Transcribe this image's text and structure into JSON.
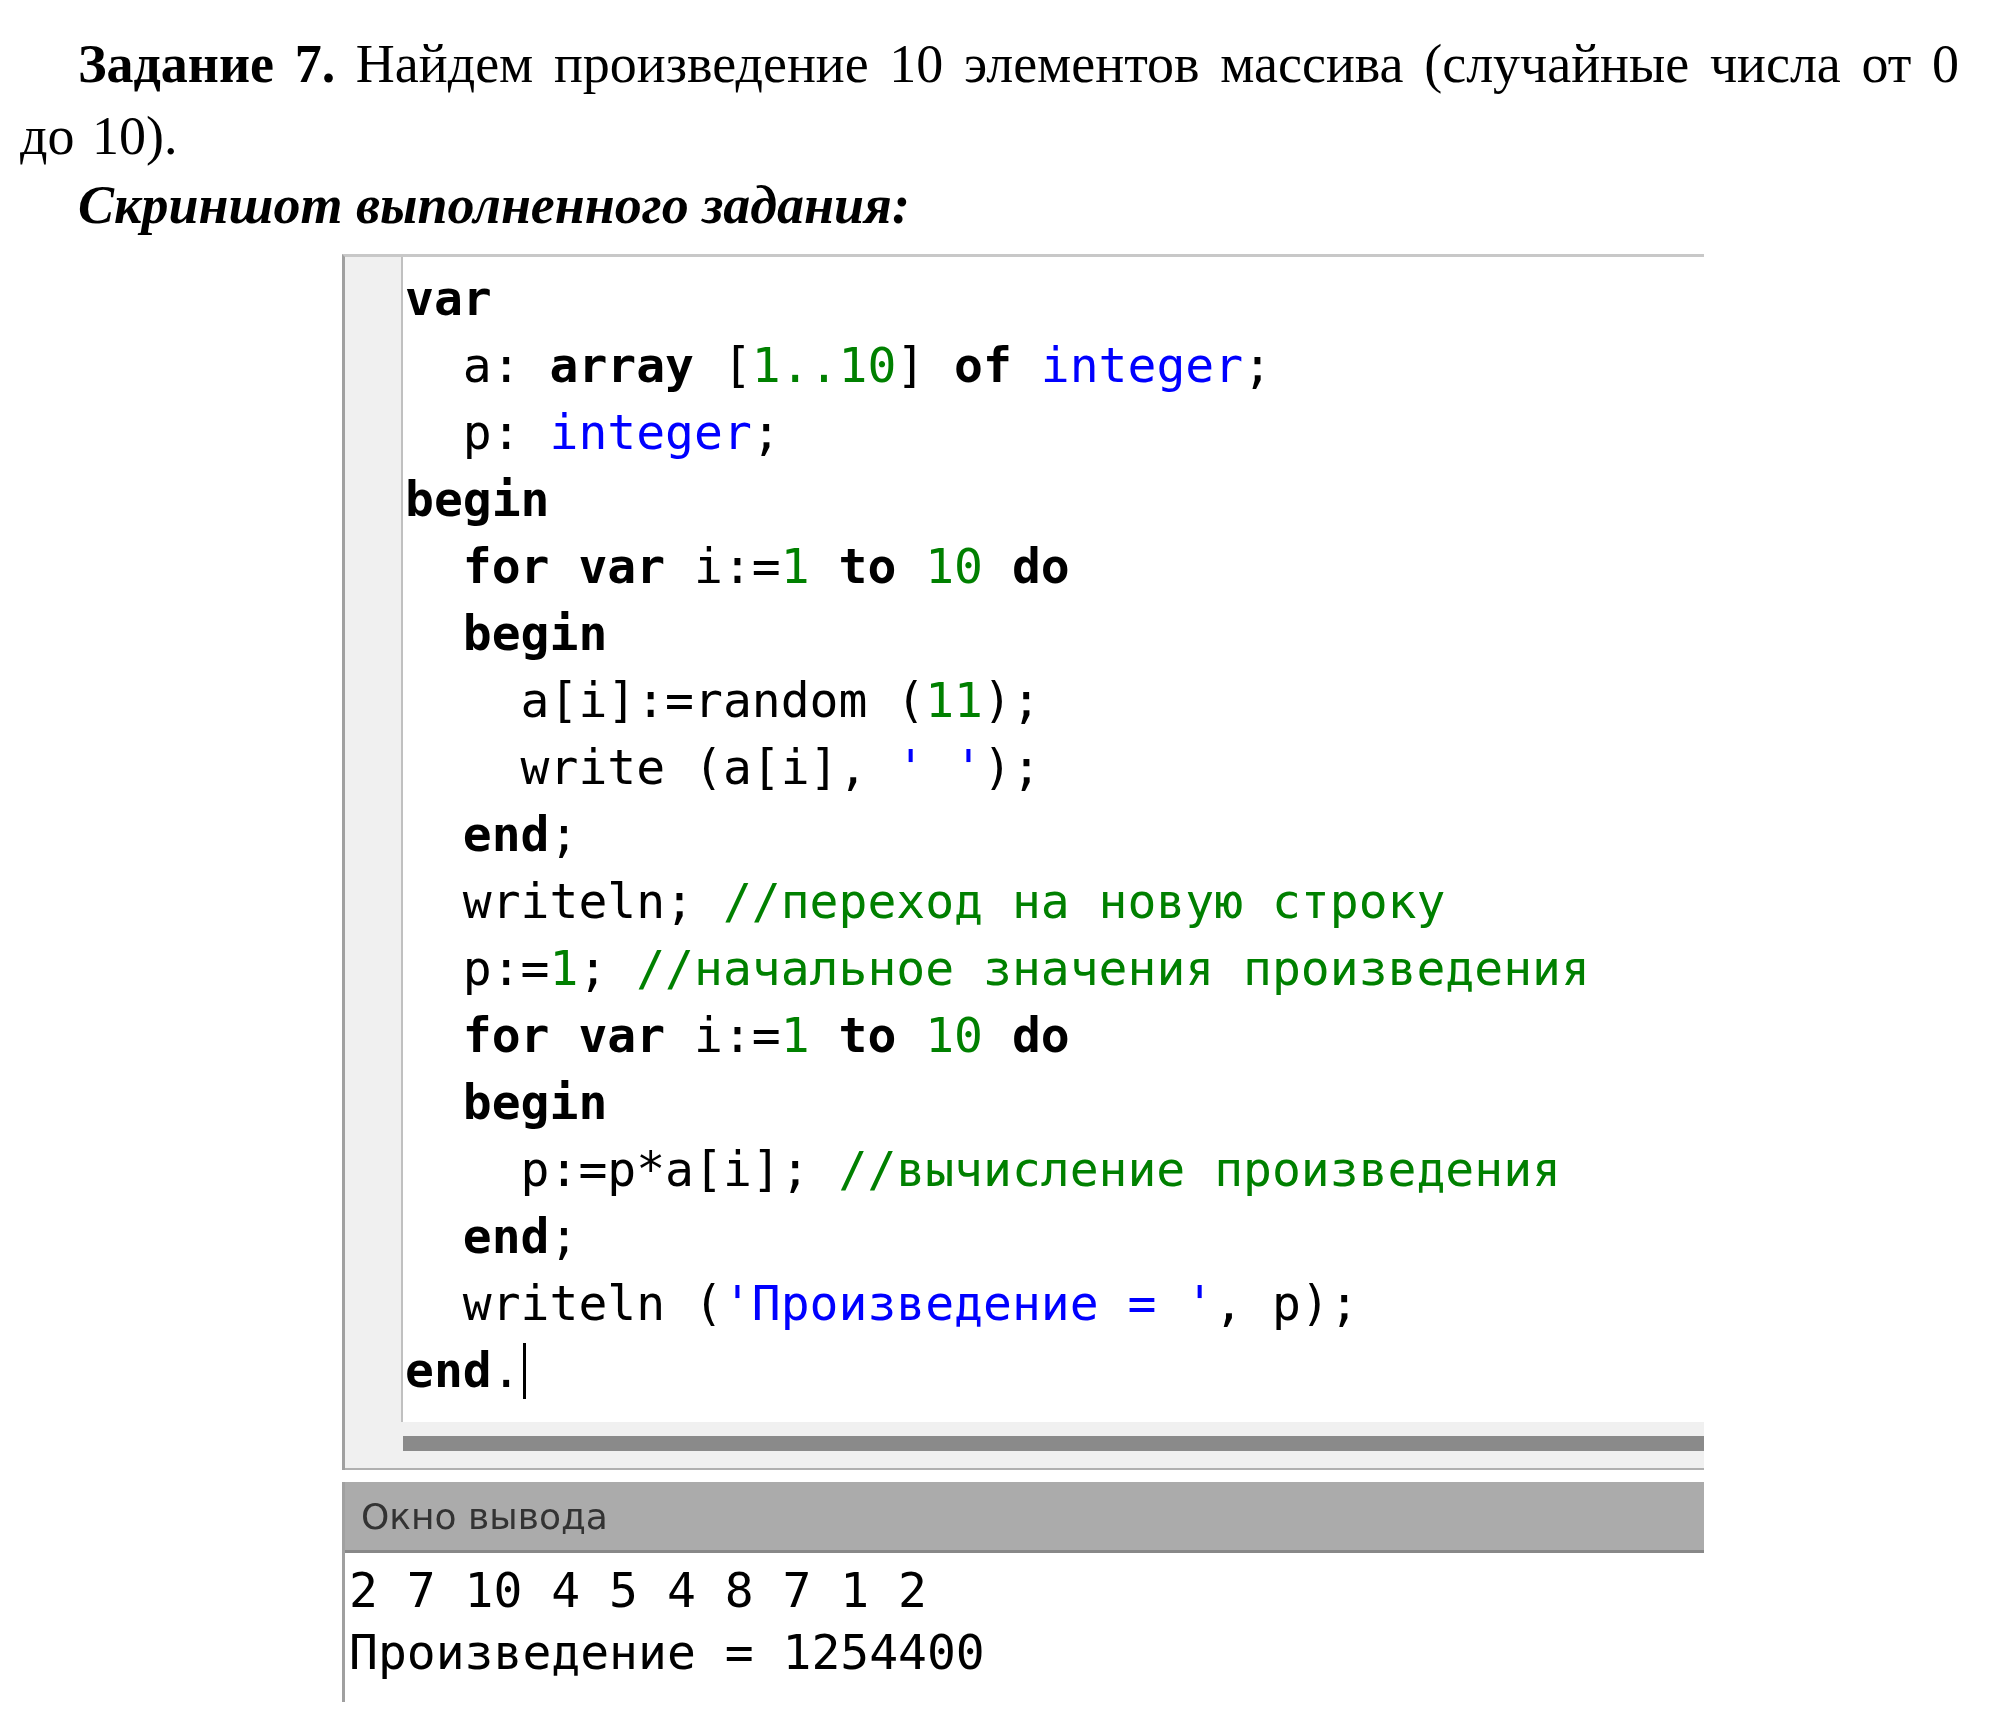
{
  "task": {
    "text": "**Задание 7.** Найдем произведение 10 элементов массива (случайные числа от 0 до 10).",
    "subtitle": "Скриншот выполненного задания:"
  },
  "editor": {
    "lines": [
      [
        {
          "kind": "keyword",
          "text": "var"
        }
      ],
      [
        {
          "kind": "plain",
          "text": "  a: "
        },
        {
          "kind": "keyword",
          "text": "array"
        },
        {
          "kind": "plain",
          "text": " ["
        },
        {
          "kind": "number",
          "text": "1..10"
        },
        {
          "kind": "plain",
          "text": "] "
        },
        {
          "kind": "keyword",
          "text": "of "
        },
        {
          "kind": "type",
          "text": "integer"
        },
        {
          "kind": "plain",
          "text": ";"
        }
      ],
      [
        {
          "kind": "plain",
          "text": "  p: "
        },
        {
          "kind": "type",
          "text": "integer"
        },
        {
          "kind": "plain",
          "text": ";"
        }
      ],
      [
        {
          "kind": "keyword",
          "text": "begin"
        }
      ],
      [
        {
          "kind": "keyword",
          "text": "  for var"
        },
        {
          "kind": "plain",
          "text": " i:="
        },
        {
          "kind": "number",
          "text": "1 "
        },
        {
          "kind": "keyword",
          "text": "to "
        },
        {
          "kind": "number",
          "text": "10 "
        },
        {
          "kind": "keyword",
          "text": "do"
        }
      ],
      [
        {
          "kind": "keyword",
          "text": "  begin"
        }
      ],
      [
        {
          "kind": "plain",
          "text": "    a[i]:=random ("
        },
        {
          "kind": "number",
          "text": "11"
        },
        {
          "kind": "plain",
          "text": ");"
        }
      ],
      [
        {
          "kind": "plain",
          "text": "    write (a[i], "
        },
        {
          "kind": "string",
          "text": "' '"
        },
        {
          "kind": "plain",
          "text": ");"
        }
      ],
      [
        {
          "kind": "keyword",
          "text": "  end"
        },
        {
          "kind": "plain",
          "text": ";"
        }
      ],
      [
        {
          "kind": "plain",
          "text": "  writeln; "
        },
        {
          "kind": "comment",
          "text": "//переход на новую строку"
        }
      ],
      [
        {
          "kind": "plain",
          "text": "  p:="
        },
        {
          "kind": "number",
          "text": "1"
        },
        {
          "kind": "plain",
          "text": "; "
        },
        {
          "kind": "comment",
          "text": "//начальное значения произведения"
        }
      ],
      [
        {
          "kind": "keyword",
          "text": "  for var"
        },
        {
          "kind": "plain",
          "text": " i:="
        },
        {
          "kind": "number",
          "text": "1 "
        },
        {
          "kind": "keyword",
          "text": "to "
        },
        {
          "kind": "number",
          "text": "10 "
        },
        {
          "kind": "keyword",
          "text": "do"
        }
      ],
      [
        {
          "kind": "keyword",
          "text": "  begin"
        }
      ],
      [
        {
          "kind": "plain",
          "text": "    p:=p*a[i]; "
        },
        {
          "kind": "comment",
          "text": "//вычисление произведения"
        }
      ],
      [
        {
          "kind": "keyword",
          "text": "  end"
        },
        {
          "kind": "plain",
          "text": ";"
        }
      ],
      [
        {
          "kind": "plain",
          "text": "  writeln ("
        },
        {
          "kind": "string",
          "text": "'Произведение = '"
        },
        {
          "kind": "plain",
          "text": ", p);"
        }
      ],
      [
        {
          "kind": "keyword",
          "text": "end"
        },
        {
          "kind": "plain",
          "text": "."
        }
      ]
    ]
  },
  "output": {
    "title": "Окно вывода",
    "lines": [
      "2 7 10 4 5 4 8 7 1 2",
      "Произведение = 1254400"
    ]
  }
}
